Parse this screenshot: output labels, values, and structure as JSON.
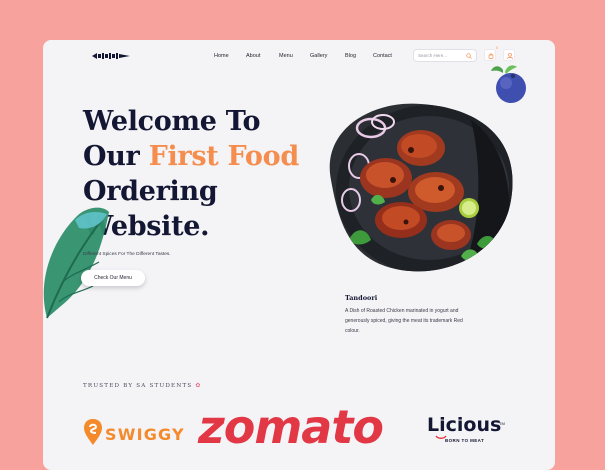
{
  "nav": {
    "items": [
      "Home",
      "About",
      "Menu",
      "Gallery",
      "Blog",
      "Contact"
    ],
    "search_placeholder": "Search Here...",
    "cart_count": "0"
  },
  "hero": {
    "title_line1": "Welcome To",
    "title_line2_prefix": "Our",
    "title_line2_accent": "First Food",
    "title_line3": "Ordering",
    "title_line4": "Website.",
    "subtext": "Different Spices For The Different Tastes.",
    "cta_label": "Check Our Menu"
  },
  "dish": {
    "title": "Tandoori",
    "description": "A Dish of Roasted Chicken marinated in yogurt and generously spiced, giving the meat its trademark Red colour."
  },
  "trusted": {
    "label": "TRUSTED BY SA STUDENTS",
    "brands": [
      "SWIGGY",
      "zomato",
      "Licious"
    ],
    "licious_tagline": "BORN TO MEAT"
  },
  "colors": {
    "background": "#F7A29C",
    "card": "#F4F3F6",
    "accent": "#F58D4E",
    "heading": "#141733",
    "zomato": "#E23744",
    "swiggy": "#F58A2B"
  },
  "icons": [
    "search-icon",
    "cart-icon",
    "user-icon",
    "blueberry-decoration",
    "leaf-decoration"
  ]
}
